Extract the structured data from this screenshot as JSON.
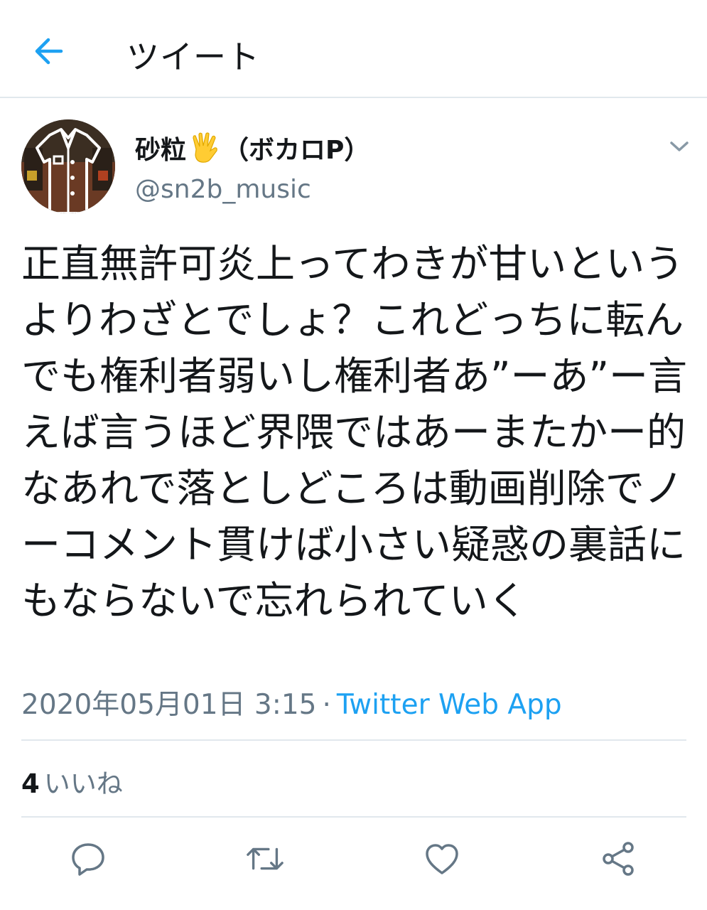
{
  "header": {
    "title": "ツイート",
    "back_icon": "arrow-left-icon",
    "accent_color": "#1da1f2"
  },
  "author": {
    "display_name": "砂粒",
    "emoji": "vulcan-salute-hand",
    "display_suffix": "（ボカロP）",
    "handle": "@sn2b_music"
  },
  "tweet": {
    "text": "正直無許可炎上ってわきが甘いというよりわざとでしょ？これどっちに転んでも権利者弱いし権利者あ”ーあ”ー言えば言うほど界隈ではあーまたかー的なあれで落としどころは動画削除でノーコメント貫けば小さい疑惑の裏話にもならないで忘れられていく",
    "timestamp": "2020年05月01日 3:15",
    "separator": "·",
    "source": "Twitter Web App"
  },
  "stats": {
    "likes_count": "4",
    "likes_label": "いいね"
  },
  "actions": [
    "reply-icon",
    "retweet-icon",
    "like-icon",
    "share-icon"
  ],
  "colors": {
    "text": "#14171a",
    "secondary": "#657786",
    "divider": "#e1e8ed",
    "link": "#1da1f2"
  }
}
